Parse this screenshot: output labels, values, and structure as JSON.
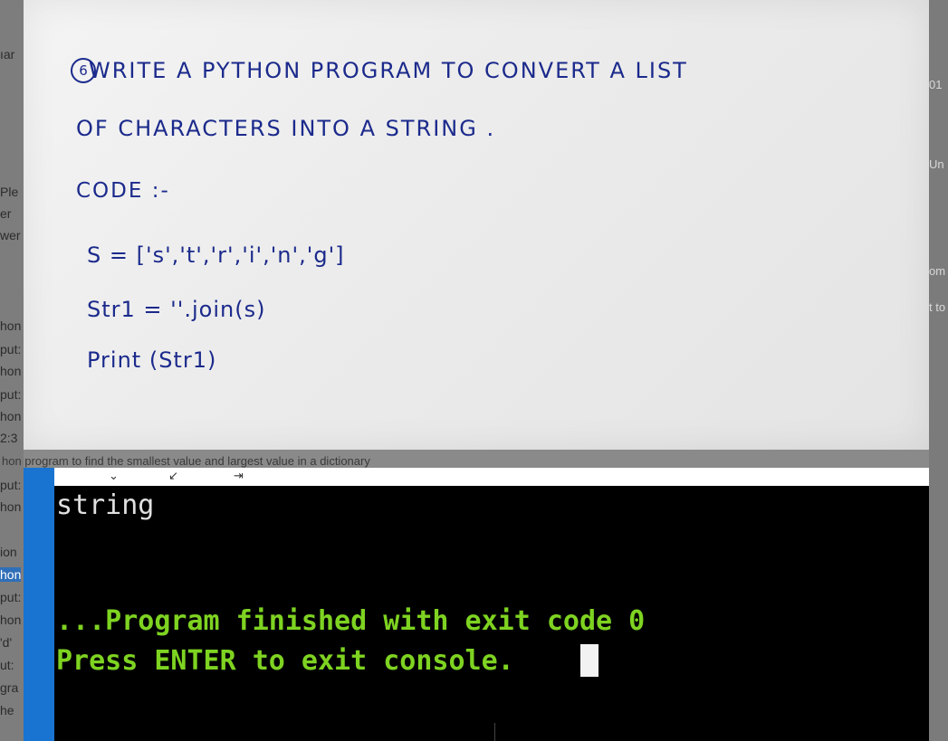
{
  "background_page": {
    "left_fragments": [
      "ıar",
      "Ple",
      "er",
      "wer",
      "hon",
      "put:",
      "hon",
      "put:",
      "hon",
      "2:3",
      "put:",
      "hon",
      "ion",
      "hon",
      "put:",
      "hon",
      "'d'",
      "ut:",
      "gra",
      "he"
    ],
    "right_fragments": [
      "01",
      "Un",
      "om",
      "t to"
    ],
    "caption": "hon program to find the smallest value and largest value in a dictionary"
  },
  "note": {
    "question_number": "6",
    "title_line1": "WRITE A PYTHON PROGRAM TO CONVERT A LIST",
    "title_line2": "OF CHARACTERS INTO A STRING .",
    "code_label": "CODE :-",
    "code_lines": [
      "S = ['s','t','r','i','n','g']",
      "Str1 = ''.join(s)",
      "Print (Str1)"
    ]
  },
  "console": {
    "output": "string",
    "finish_message": "...Program finished with exit code 0",
    "prompt_message": "Press ENTER to exit console."
  },
  "colors": {
    "ink": "#1b2a8c",
    "console_bg": "#000000",
    "console_green": "#7ed321",
    "accent_blue": "#1874d0"
  }
}
